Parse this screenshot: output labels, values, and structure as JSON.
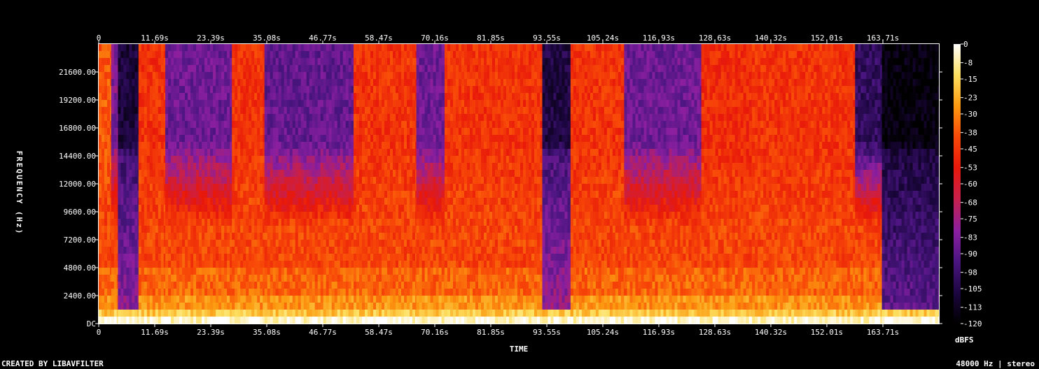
{
  "chart_data": {
    "type": "heatmap",
    "title": "",
    "xlabel": "TIME",
    "ylabel": "FREQUENCY (Hz)",
    "colorbar_label": "dBFS",
    "x_ticks": [
      "0",
      "11.69s",
      "23.39s",
      "35.08s",
      "46.77s",
      "58.47s",
      "70.16s",
      "81.85s",
      "93.55s",
      "105.24s",
      "116.93s",
      "128.63s",
      "140.32s",
      "152.01s",
      "163.71s"
    ],
    "x_tick_values": [
      0,
      11.69,
      23.39,
      35.08,
      46.77,
      58.47,
      70.16,
      81.85,
      93.55,
      105.24,
      116.93,
      128.63,
      140.32,
      152.01,
      163.71
    ],
    "xlim": [
      0,
      175.4
    ],
    "y_ticks": [
      "DC",
      "2400.00",
      "4800.00",
      "7200.00",
      "9600.00",
      "12000.00",
      "14400.00",
      "16800.00",
      "19200.00",
      "21600.00"
    ],
    "y_tick_values": [
      0,
      2400,
      4800,
      7200,
      9600,
      12000,
      14400,
      16800,
      19200,
      21600
    ],
    "ylim": [
      0,
      24000
    ],
    "colorbar_ticks": [
      "0",
      "-8",
      "-15",
      "-23",
      "-30",
      "-38",
      "-45",
      "-53",
      "-60",
      "-68",
      "-75",
      "-83",
      "-90",
      "-98",
      "-105",
      "-113",
      "-120"
    ],
    "colorbar_values": [
      0,
      -8,
      -15,
      -23,
      -30,
      -38,
      -45,
      -53,
      -60,
      -68,
      -75,
      -83,
      -90,
      -98,
      -105,
      -113,
      -120
    ],
    "colorbar_range": [
      -120,
      0
    ],
    "colormap": [
      "#000000",
      "#1c0640",
      "#4a1580",
      "#8a1fa0",
      "#c8204a",
      "#e8180a",
      "#f84a08",
      "#fc9a10",
      "#fde060",
      "#ffffff"
    ],
    "segments": [
      {
        "t0": 0,
        "t1": 2.6,
        "hi_level": -38
      },
      {
        "t0": 2.6,
        "t1": 4.0,
        "hi_level": -82
      },
      {
        "t0": 4.0,
        "t1": 8.3,
        "hi_level": -108
      },
      {
        "t0": 8.3,
        "t1": 13.9,
        "hi_level": -46
      },
      {
        "t0": 13.9,
        "t1": 27.8,
        "hi_level": -86
      },
      {
        "t0": 27.8,
        "t1": 34.6,
        "hi_level": -46
      },
      {
        "t0": 34.6,
        "t1": 53.2,
        "hi_level": -88
      },
      {
        "t0": 53.2,
        "t1": 66.3,
        "hi_level": -46
      },
      {
        "t0": 66.3,
        "t1": 72.2,
        "hi_level": -86
      },
      {
        "t0": 72.2,
        "t1": 92.6,
        "hi_level": -46
      },
      {
        "t0": 92.6,
        "t1": 98.5,
        "hi_level": -106
      },
      {
        "t0": 98.5,
        "t1": 109.7,
        "hi_level": -46
      },
      {
        "t0": 109.7,
        "t1": 125.8,
        "hi_level": -86
      },
      {
        "t0": 125.8,
        "t1": 136.4,
        "hi_level": -48
      },
      {
        "t0": 136.4,
        "t1": 157.9,
        "hi_level": -46
      },
      {
        "t0": 157.9,
        "t1": 163.5,
        "hi_level": -100
      },
      {
        "t0": 163.5,
        "t1": 175.4,
        "hi_level": -118
      }
    ]
  },
  "footer": {
    "left": "CREATED BY LIBAVFILTER",
    "right": "48000 Hz | stereo"
  }
}
